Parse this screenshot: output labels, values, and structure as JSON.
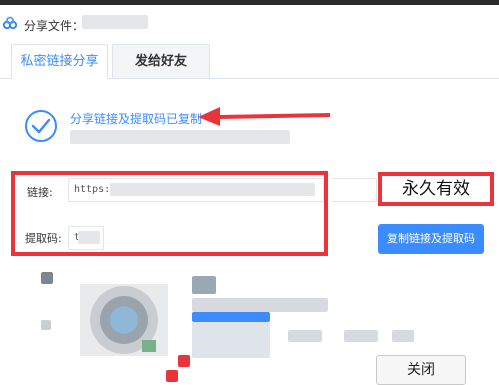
{
  "window": {
    "title": "分享文件："
  },
  "tabs": [
    {
      "label": "私密链接分享",
      "active": true
    },
    {
      "label": "发给好友",
      "active": false
    }
  ],
  "status": {
    "message": "分享链接及提取码已复制"
  },
  "link": {
    "label": "链接:",
    "value": "https:"
  },
  "code": {
    "label": "提取码:",
    "value": "t"
  },
  "annotation": {
    "text": "永久有效"
  },
  "buttons": {
    "copy": "复制链接及提取码",
    "close": "关闭"
  },
  "colors": {
    "accent": "#3b8cff",
    "highlight": "#e8343a"
  }
}
